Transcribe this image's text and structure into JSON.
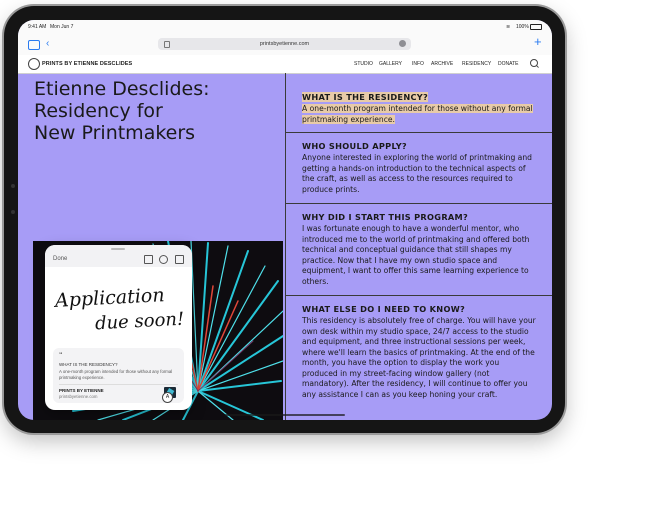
{
  "status_bar": {
    "time": "9:41 AM",
    "date": "Mon Jun 7",
    "battery": "100%"
  },
  "browser": {
    "address": "printsbyetienne.com"
  },
  "site": {
    "brand": "PRINTS BY ETIENNE DESCLIDES",
    "nav": [
      "STUDIO",
      "GALLERY",
      "INFO",
      "ARCHIVE",
      "RESIDENCY",
      "DONATE"
    ]
  },
  "page": {
    "title_lines": [
      "Etienne Desclides:",
      "Residency for",
      "New Printmakers"
    ],
    "faqs": [
      {
        "q": "WHAT IS THE RESIDENCY?",
        "a": "A one-month program intended for those without any formal printmaking experience."
      },
      {
        "q": "WHO SHOULD APPLY?",
        "a": "Anyone interested in exploring the world of printmaking and getting a hands-on introduction to the technical aspects of the craft, as well as access to the resources required to produce prints."
      },
      {
        "q": "WHY DID I START THIS PROGRAM?",
        "a": "I was fortunate enough to have a wonderful mentor, who introduced me to the world of printmaking and offered both technical and conceptual guidance that still shapes my practice. Now that I have my own studio space and equipment, I want to offer this same learning experience to others."
      },
      {
        "q": "WHAT ELSE DO I NEED TO KNOW?",
        "a": "This residency is absolutely free of charge. You will have your own desk within my studio space, 24/7 access to the studio and equipment, and three instructional sessions per week, where we'll learn the basics of printmaking. At the end of the month, you have the option to display the work you produced in my street-facing window gallery (not mandatory). After the residency, I will continue to offer you any assistance I can as you keep honing your craft."
      }
    ]
  },
  "quick_note": {
    "done_label": "Done",
    "handwriting": [
      "Application",
      "due soon!"
    ],
    "quote_mark": "“",
    "card_question": "WHAT IS THE RESIDENCY?",
    "card_text": "A one-month program intended for those without any formal printmaking experience.",
    "card_site": "PRINTS BY ETIENNE",
    "card_url": "printsbyetienne.com",
    "pin_label": "A"
  },
  "colors": {
    "page_bg": "#a79cf6",
    "highlight": "#e8cba8",
    "accent": "#2a7bf0"
  }
}
